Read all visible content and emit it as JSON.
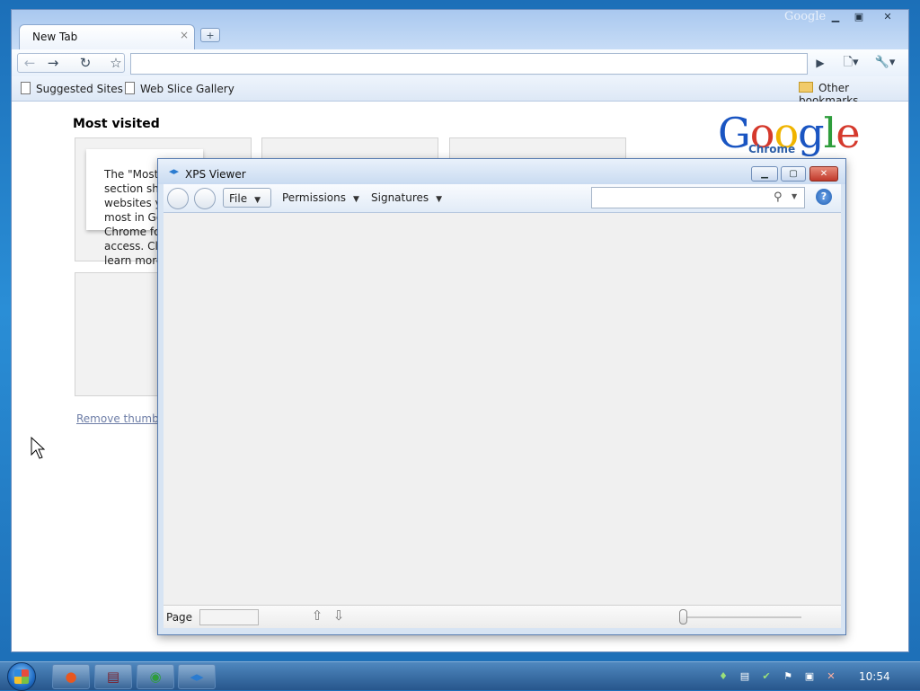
{
  "chrome": {
    "tab_title": "New Tab",
    "tab_close": "×",
    "new_tab": "+",
    "watermark": "Google",
    "bookmarks": [
      "Suggested Sites",
      "Web Slice Gallery"
    ],
    "other_bookmarks": "Other bookmarks",
    "content": {
      "heading": "Most visited",
      "tip_text": "The \"Most visited\" section shows the websites you use most in Google Chrome for quick access. Click learn more",
      "remove_link": "Remove thumbnails"
    },
    "logo_letters": [
      {
        "ch": "G",
        "color": "#1a55c2"
      },
      {
        "ch": "o",
        "color": "#d5392c"
      },
      {
        "ch": "o",
        "color": "#f0b400"
      },
      {
        "ch": "g",
        "color": "#1a55c2"
      },
      {
        "ch": "l",
        "color": "#2e9d3c"
      },
      {
        "ch": "e",
        "color": "#d5392c"
      }
    ],
    "logo_sub": "Chrome"
  },
  "xps": {
    "title": "XPS Viewer",
    "menus": {
      "file": "File",
      "permissions": "Permissions",
      "signatures": "Signatures"
    },
    "status_page_label": "Page"
  },
  "taskbar": {
    "clock": "10:54"
  }
}
